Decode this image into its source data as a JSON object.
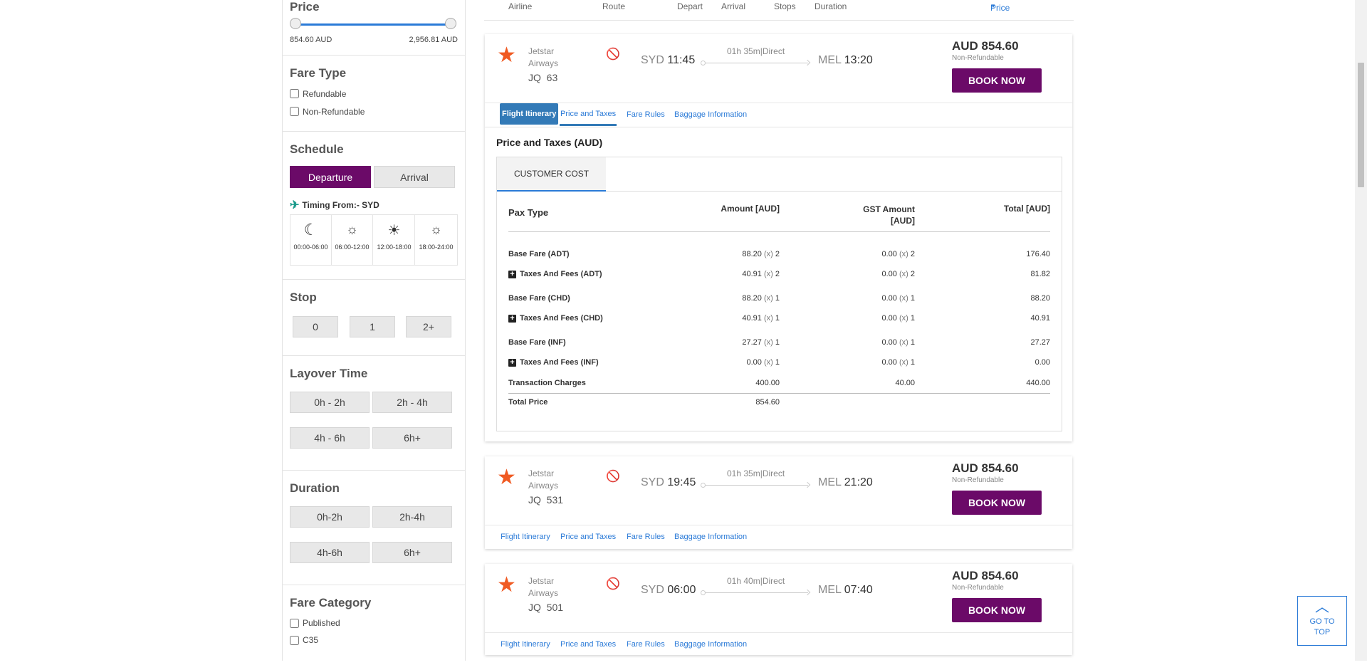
{
  "filters": {
    "price": {
      "title": "Price",
      "min": "854.60 AUD",
      "max": "2,956.81 AUD"
    },
    "fare_type": {
      "title": "Fare Type",
      "options": [
        "Refundable",
        "Non-Refundable"
      ]
    },
    "schedule": {
      "title": "Schedule",
      "tabs": [
        "Departure",
        "Arrival"
      ],
      "timing": "Timing From:- SYD",
      "slots": [
        "00:00-06:00",
        "06:00-12:00",
        "12:00-18:00",
        "18:00-24:00"
      ]
    },
    "stop": {
      "title": "Stop",
      "options": [
        "0",
        "1",
        "2+"
      ]
    },
    "layover": {
      "title": "Layover Time",
      "options": [
        "0h - 2h",
        "2h - 4h",
        "4h - 6h",
        "6h+"
      ]
    },
    "duration": {
      "title": "Duration",
      "options": [
        "0h-2h",
        "2h-4h",
        "4h-6h",
        "6h+"
      ]
    },
    "fare_category": {
      "title": "Fare Category",
      "options": [
        "Published",
        "C35"
      ]
    }
  },
  "header": {
    "airline": "Airline",
    "route": "Route",
    "depart": "Depart",
    "arrival": "Arrival",
    "stops": "Stops",
    "duration": "Duration",
    "price": "Price"
  },
  "tabs": [
    "Flight Itinerary",
    "Price and Taxes",
    "Fare Rules",
    "Baggage Information"
  ],
  "flights": [
    {
      "airline1": "Jetstar",
      "airline2": "Airways",
      "code": "JQ",
      "number": "63",
      "from": "SYD",
      "dep": "11:45",
      "to": "MEL",
      "arr": "13:20",
      "dur": "01h 35m|Direct",
      "price": "AUD 854.60",
      "refund": "Non-Refundable",
      "book": "BOOK NOW"
    },
    {
      "airline1": "Jetstar",
      "airline2": "Airways",
      "code": "JQ",
      "number": "531",
      "from": "SYD",
      "dep": "19:45",
      "to": "MEL",
      "arr": "21:20",
      "dur": "01h 35m|Direct",
      "price": "AUD 854.60",
      "refund": "Non-Refundable",
      "book": "BOOK NOW"
    },
    {
      "airline1": "Jetstar",
      "airline2": "Airways",
      "code": "JQ",
      "number": "501",
      "from": "SYD",
      "dep": "06:00",
      "to": "MEL",
      "arr": "07:40",
      "dur": "01h 40m|Direct",
      "price": "AUD 854.60",
      "refund": "Non-Refundable",
      "book": "BOOK NOW"
    }
  ],
  "taxes": {
    "title": "Price and Taxes (AUD)",
    "tab": "CUSTOMER COST",
    "cols": [
      "Pax Type",
      "Amount [AUD]",
      "GST Amount [AUD]",
      "Total [AUD]"
    ],
    "rows": [
      {
        "label": "Base Fare (ADT)",
        "expand": false,
        "amt": "88.20",
        "amt_x": "2",
        "gst": "0.00",
        "gst_x": "2",
        "total": "176.40"
      },
      {
        "label": "Taxes And Fees (ADT)",
        "expand": true,
        "amt": "40.91",
        "amt_x": "2",
        "gst": "0.00",
        "gst_x": "2",
        "total": "81.82"
      },
      {
        "label": "Base Fare (CHD)",
        "expand": false,
        "amt": "88.20",
        "amt_x": "1",
        "gst": "0.00",
        "gst_x": "1",
        "total": "88.20"
      },
      {
        "label": "Taxes And Fees (CHD)",
        "expand": true,
        "amt": "40.91",
        "amt_x": "1",
        "gst": "0.00",
        "gst_x": "1",
        "total": "40.91"
      },
      {
        "label": "Base Fare (INF)",
        "expand": false,
        "amt": "27.27",
        "amt_x": "1",
        "gst": "0.00",
        "gst_x": "1",
        "total": "27.27"
      },
      {
        "label": "Taxes And Fees (INF)",
        "expand": true,
        "amt": "0.00",
        "amt_x": "1",
        "gst": "0.00",
        "gst_x": "1",
        "total": "0.00"
      }
    ],
    "x_label": "(x)",
    "transaction": {
      "label": "Transaction Charges",
      "amt": "400.00",
      "gst": "40.00",
      "total": "440.00"
    },
    "total": {
      "label": "Total Price",
      "amt": "854.60"
    }
  },
  "goto_top": "GO TO TOP"
}
